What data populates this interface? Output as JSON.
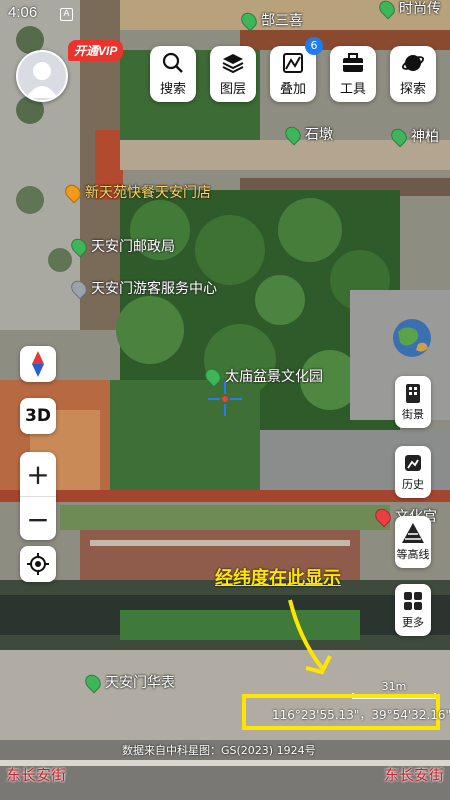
{
  "status_bar": {
    "time": "4:06",
    "notif": "A"
  },
  "vip_badge": "开通VIP",
  "toolbar": {
    "items": [
      {
        "label": "搜索",
        "icon": "search-icon"
      },
      {
        "label": "图层",
        "icon": "layers-icon"
      },
      {
        "label": "叠加",
        "icon": "overlay-icon",
        "badge": "6"
      },
      {
        "label": "工具",
        "icon": "toolbox-icon"
      },
      {
        "label": "探索",
        "icon": "planet-icon"
      }
    ]
  },
  "pois": {
    "top1": "郜三喜",
    "top2": "时尚传",
    "shidun": "石墩",
    "shenbo": "神柏",
    "restaurant": "新天苑快餐天安门店",
    "post_office": "天安门邮政局",
    "visitor_center": "天安门游客服务中心",
    "park": "太庙盆景文化园",
    "palace": "文化宫",
    "huabiao": "天安门华表"
  },
  "left_controls": {
    "compass": "compass-icon",
    "btn_3d": "3D",
    "zoom_in": "+",
    "zoom_out": "−",
    "locate": "locate-icon"
  },
  "right_controls": [
    {
      "label": "街景",
      "icon": "streetview-icon"
    },
    {
      "label": "历史",
      "icon": "history-icon"
    },
    {
      "label": "等高线",
      "icon": "contour-icon"
    },
    {
      "label": "更多",
      "icon": "grid-icon"
    }
  ],
  "annotation": "经纬度在此显示",
  "scale": "31m",
  "coordinates": "116°23'55.13\"，39°54'32.16\"",
  "credit": "数据来自中科星图：GS(2023) 1924号",
  "streets": {
    "left": "东长安街",
    "right": "东长安街"
  },
  "colors": {
    "accent_blue": "#1e7bf0",
    "vip_red": "#e8342c",
    "annotation_yellow": "#ffe600"
  }
}
